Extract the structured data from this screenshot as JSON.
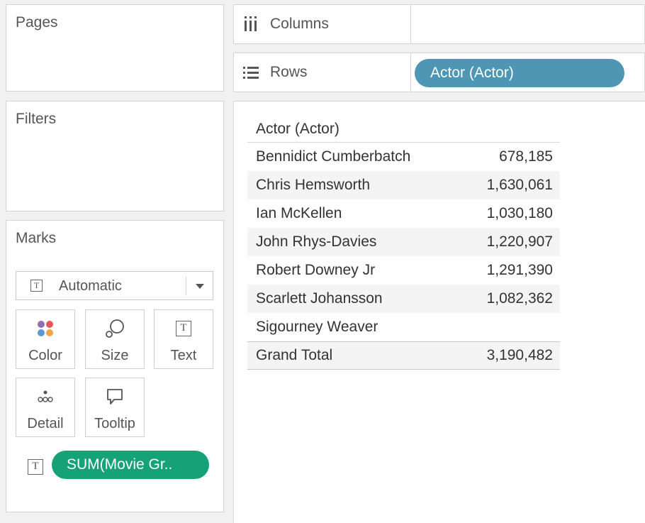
{
  "cards": {
    "pages": "Pages",
    "filters": "Filters",
    "marks": "Marks"
  },
  "shelves": {
    "columns_label": "Columns",
    "rows_label": "Rows",
    "rows_pill": "Actor (Actor)"
  },
  "marks": {
    "type": "Automatic",
    "buttons": {
      "color": "Color",
      "size": "Size",
      "text": "Text",
      "detail": "Detail",
      "tooltip": "Tooltip"
    },
    "text_pill": "SUM(Movie Gr.."
  },
  "table": {
    "header": "Actor (Actor)",
    "rows": [
      {
        "name": "Bennidict Cumberbatch",
        "value": "678,185"
      },
      {
        "name": "Chris Hemsworth",
        "value": "1,630,061"
      },
      {
        "name": "Ian McKellen",
        "value": "1,030,180"
      },
      {
        "name": "John Rhys-Davies",
        "value": "1,220,907"
      },
      {
        "name": "Robert Downey Jr",
        "value": "1,291,390"
      },
      {
        "name": "Scarlett Johansson",
        "value": "1,082,362"
      },
      {
        "name": "Sigourney Weaver",
        "value": ""
      }
    ],
    "total": {
      "name": "Grand Total",
      "value": "3,190,482"
    }
  },
  "colors": {
    "rows_pill": "#4e96b4",
    "measure_pill": "#15a277"
  }
}
